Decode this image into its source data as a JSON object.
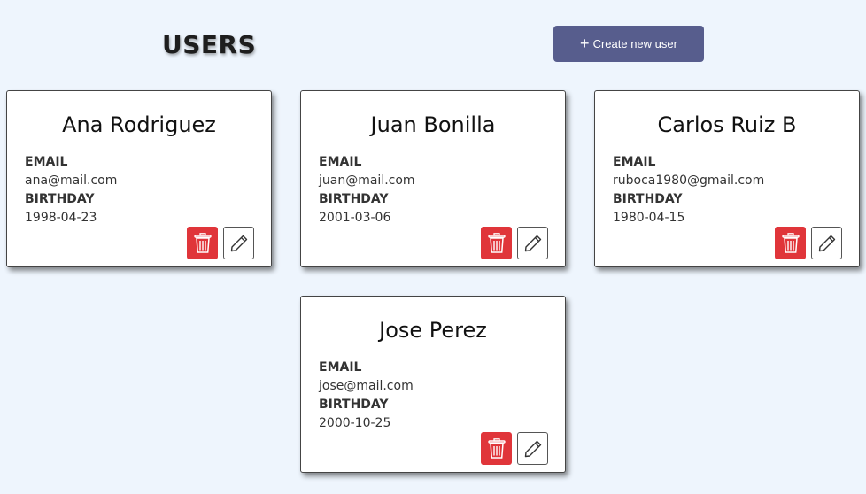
{
  "header": {
    "title": "USERS",
    "create_label": "Create new user",
    "create_icon": "plus-icon"
  },
  "labels": {
    "email": "EMAIL",
    "birthday": "BIRTHDAY"
  },
  "users": [
    {
      "name": "Ana Rodriguez",
      "email": "ana@mail.com",
      "birthday": "1998-04-23"
    },
    {
      "name": "Juan Bonilla",
      "email": "juan@mail.com",
      "birthday": "2001-03-06"
    },
    {
      "name": "Carlos Ruiz B",
      "email": "ruboca1980@gmail.com",
      "birthday": "1980-04-15"
    },
    {
      "name": "Jose Perez",
      "email": "jose@mail.com",
      "birthday": "2000-10-25"
    }
  ],
  "icons": {
    "delete": "trash-icon",
    "edit": "pencil-icon"
  },
  "colors": {
    "background": "#eef5fd",
    "create_button": "#575d8d",
    "delete_button": "#e0353a"
  }
}
